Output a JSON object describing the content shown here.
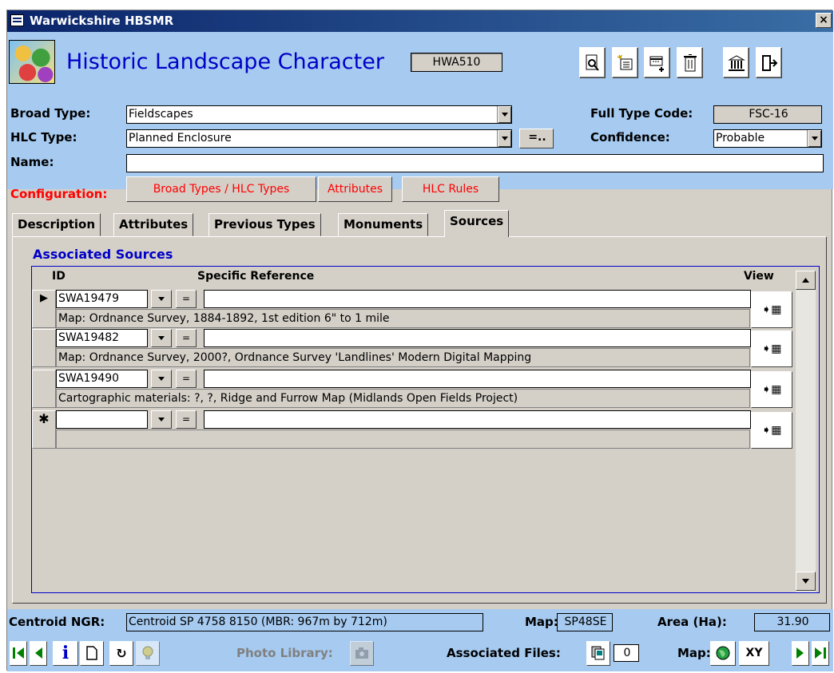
{
  "window": {
    "title": "Warwickshire HBSMR",
    "close": "×"
  },
  "header": {
    "title": "Historic Landscape Character",
    "record_code": "HWA510"
  },
  "toolbar": {
    "icons": [
      "find-record-icon",
      "new-record-icon",
      "copy-record-icon",
      "delete-icon",
      "monument-icon",
      "exit-icon"
    ]
  },
  "form": {
    "broad_type_label": "Broad Type:",
    "broad_type_value": "Fieldscapes",
    "hlc_type_label": "HLC Type:",
    "hlc_type_value": "Planned Enclosure",
    "eq_button": "=..",
    "name_label": "Name:",
    "name_value": "",
    "full_type_label": "Full Type Code:",
    "full_type_value": "FSC-16",
    "confidence_label": "Confidence:",
    "confidence_value": "Probable"
  },
  "config": {
    "label": "Configuration:",
    "buttons": [
      "Broad Types / HLC Types",
      "Attributes",
      "HLC Rules"
    ]
  },
  "tabs": [
    "Description",
    "Attributes",
    "Previous Types",
    "Monuments",
    "Sources"
  ],
  "active_tab": "Sources",
  "sources": {
    "section_title": "Associated Sources",
    "columns": {
      "id": "ID",
      "ref": "Specific Reference",
      "view": "View"
    },
    "eq": "=",
    "rows": [
      {
        "id": "SWA19479",
        "ref": "",
        "desc": "Map: Ordnance Survey, 1884-1892, 1st edition 6\" to 1 mile"
      },
      {
        "id": "SWA19482",
        "ref": "",
        "desc": "Map: Ordnance Survey, 2000?, Ordnance Survey 'Landlines' Modern Digital Mapping"
      },
      {
        "id": "SWA19490",
        "ref": "",
        "desc": "Cartographic materials: ?, ?, Ridge and Furrow Map (Midlands Open Fields Project)"
      },
      {
        "id": "",
        "ref": "",
        "desc": ""
      }
    ],
    "new_row_marker": "✱",
    "current_row_marker": "▶"
  },
  "footer": {
    "centroid_label": "Centroid NGR:",
    "centroid_value": "Centroid SP 4758 8150  (MBR: 967m by 712m)",
    "map_label": "Map:",
    "map_value": "SP48SE",
    "area_label": "Area (Ha):",
    "area_value": "31.90",
    "photo_label": "Photo Library:",
    "files_label": "Associated Files:",
    "files_count": "0",
    "map2_label": "Map:",
    "xy_label": "XY"
  },
  "colors": {
    "header_bg": "#a6caf0",
    "title_blue": "#0000c8",
    "config_red": "#ff0000",
    "form_bg": "#d4d0c8"
  }
}
